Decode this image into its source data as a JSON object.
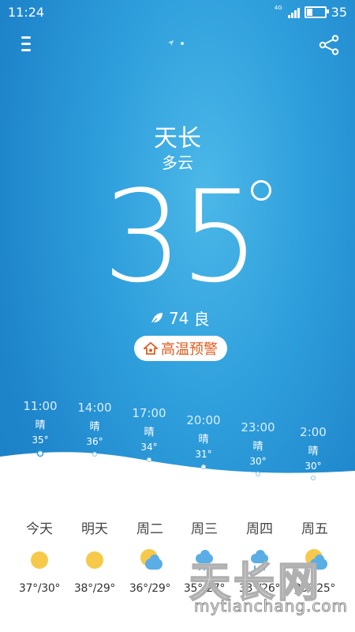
{
  "status_bar": {
    "time": "11:24",
    "network": "4G",
    "battery_level": "35",
    "battery_fraction": 0.35
  },
  "header": {
    "menu_icon": "menu-icon",
    "share_icon": "share-icon"
  },
  "current": {
    "city": "天长",
    "condition": "多云",
    "temperature": "35",
    "aqi_value": "74",
    "aqi_level": "良",
    "alert": "高温预警"
  },
  "hourly": [
    {
      "time": "11:00",
      "weather": "晴",
      "temp": "35°"
    },
    {
      "time": "14:00",
      "weather": "晴",
      "temp": "36°"
    },
    {
      "time": "17:00",
      "weather": "晴",
      "temp": "34°"
    },
    {
      "time": "20:00",
      "weather": "晴",
      "temp": "31°"
    },
    {
      "time": "23:00",
      "weather": "晴",
      "temp": "30°"
    },
    {
      "time": "2:00",
      "weather": "晴",
      "temp": "30°"
    }
  ],
  "daily": [
    {
      "day": "今天",
      "range": "37°/30°",
      "icon": "sun-icon"
    },
    {
      "day": "明天",
      "range": "38°/29°",
      "icon": "sun-icon"
    },
    {
      "day": "周二",
      "range": "36°/29°",
      "icon": "partly-cloudy-icon"
    },
    {
      "day": "周三",
      "range": "35°/27°",
      "icon": "rain-cloud-icon"
    },
    {
      "day": "周四",
      "range": "33°/26°",
      "icon": "rain-cloud-icon"
    },
    {
      "day": "周五",
      "range": "35°/25°",
      "icon": "partly-cloudy-icon"
    }
  ],
  "watermark": {
    "big": "天长网",
    "small": "mytianchang.com"
  },
  "colors": {
    "sky": "#2f9fdc",
    "alert_text": "#e05c20",
    "sun": "#f7c94a",
    "cloud": "#5aaee5"
  }
}
